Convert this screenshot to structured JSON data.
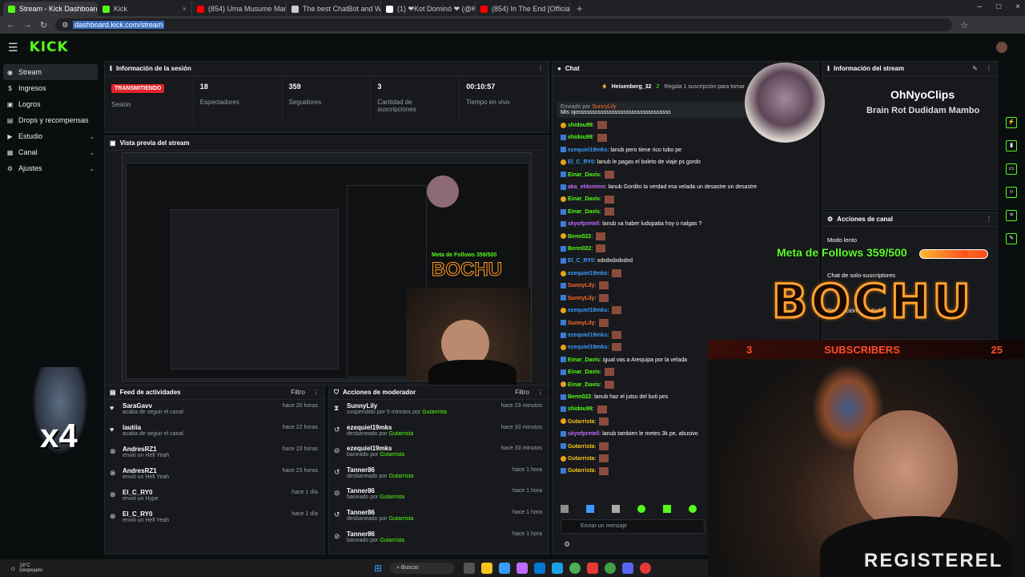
{
  "browser": {
    "tabs": [
      {
        "label": "Stream - Kick Dashboard",
        "active": true,
        "color": "#53fc18"
      },
      {
        "label": "Kick",
        "active": false,
        "color": "#53fc18"
      },
      {
        "label": "(854) Uma Musume Mambo #",
        "active": false,
        "color": "#ff0000"
      },
      {
        "label": "The best ChatBot and Widget",
        "active": false,
        "color": "#cccccc"
      },
      {
        "label": "(1) ❤Kot Dominó ❤ (@KotD",
        "active": false,
        "color": "#ffffff"
      },
      {
        "label": "(854) In The End [Official HD M",
        "active": false,
        "color": "#ff0000"
      }
    ],
    "url": "dashboard.kick.com/stream",
    "tab_close": "×",
    "new_tab": "+",
    "win_min": "–",
    "win_max": "□",
    "win_close": "×",
    "nav_back": "←",
    "nav_forward": "→",
    "nav_reload": "↻"
  },
  "kick": {
    "logo": "KICK"
  },
  "sidebar": [
    {
      "label": "Stream",
      "icon": "◉",
      "active": true
    },
    {
      "label": "Ingresos",
      "icon": "$"
    },
    {
      "label": "Logros",
      "icon": "▣"
    },
    {
      "label": "Drops y recompensas",
      "icon": "▤"
    },
    {
      "label": "Estudio",
      "icon": "▶",
      "chev": "⌄"
    },
    {
      "label": "Canal",
      "icon": "▦",
      "chev": "⌄"
    },
    {
      "label": "Ajustes",
      "icon": "⚙",
      "chev": "⌄"
    }
  ],
  "session": {
    "title": "Información de la sesión",
    "live_badge": "TRANSMITIENDO",
    "stats": [
      {
        "value": "",
        "label": "Sesión"
      },
      {
        "value": "18",
        "label": "Espectadores"
      },
      {
        "value": "359",
        "label": "Seguidores"
      },
      {
        "value": "3",
        "label": "Cantidad de suscripciones"
      },
      {
        "value": "00:10:57",
        "label": "Tiempo en vivo"
      }
    ]
  },
  "preview": {
    "title": "Vista previa del stream"
  },
  "activity": {
    "title": "Feed de actividades",
    "filter": "Filtro",
    "items": [
      {
        "icon": "♥",
        "user": "SaraGavv",
        "text": "acaba de seguir el canal",
        "time": "hace 20 horas"
      },
      {
        "icon": "♥",
        "user": "lautiia",
        "text": "acaba de seguir el canal",
        "time": "hace 22 horas"
      },
      {
        "icon": "⊗",
        "user": "AndresRZ1",
        "text": "envió un Hell Yeah",
        "extra": "1",
        "time": "hace 23 horas"
      },
      {
        "icon": "⊗",
        "user": "AndresRZ1",
        "text": "envió un Hell Yeah",
        "extra": "1",
        "time": "hace 23 horas"
      },
      {
        "icon": "⊗",
        "user": "El_C_RY0",
        "text": "envió un Hype",
        "extra": "10",
        "time": "hace 1 día"
      },
      {
        "icon": "⊗",
        "user": "El_C_RY0",
        "text": "envió un Hell Yeah",
        "extra": "1",
        "time": "hace 1 día"
      }
    ]
  },
  "mod": {
    "title": "Acciones de moderador",
    "filter": "Filtro",
    "items": [
      {
        "icon": "⧗",
        "user": "SunnyLily",
        "text": "suspendido por 5 minutos por",
        "by": "Gutarrista",
        "time": "hace 23 minutos"
      },
      {
        "icon": "↺",
        "user": "ezequiel19mks",
        "text": "desbaneado por",
        "by": "Gutarrista",
        "time": "hace 33 minutos"
      },
      {
        "icon": "⊘",
        "user": "ezequiel19mks",
        "text": "baneado por",
        "by": "Gutarrista",
        "time": "hace 33 minutos"
      },
      {
        "icon": "↺",
        "user": "Tanner86",
        "text": "desbaneado por",
        "by": "Gutarrista",
        "time": "hace 1 hora"
      },
      {
        "icon": "⊘",
        "user": "Tanner86",
        "text": "baneado por",
        "by": "Gutarrista",
        "time": "hace 1 hora"
      },
      {
        "icon": "↺",
        "user": "Tanner86",
        "text": "desbaneado por",
        "by": "Gutarrista",
        "time": "hace 1 hora"
      },
      {
        "icon": "⊘",
        "user": "Tanner86",
        "text": "baneado por",
        "by": "Gutarrista",
        "time": "hace 1 hora"
      }
    ]
  },
  "chat": {
    "title": "Chat",
    "pinned_user": "Heisenberg_32",
    "pinned_count": "2",
    "pinned_text": "Regala 1 suscripción para tomar",
    "reply_label": "Enviado por",
    "reply_user": "SunnyLily",
    "reply_text": "Mis ojosssssssssssssssssssssssssssssssss",
    "messages": [
      {
        "user": "shidou99",
        "cls": "u1",
        "text": "",
        "emote": true
      },
      {
        "user": "shidou99",
        "cls": "u1",
        "text": "",
        "emote": true
      },
      {
        "user": "ezequiel19mks",
        "cls": "u2",
        "text": "lanub pero tiene rico tubo pe"
      },
      {
        "user": "El_C_RY0",
        "cls": "u2",
        "text": "lanub le pagas el boleto de viaje ps gordo"
      },
      {
        "user": "Einar_Davis",
        "cls": "u1",
        "text": "",
        "emote": true
      },
      {
        "user": "aka_eldomino",
        "cls": "u3",
        "text": "lanub Gordito la verdad esa velada un desastre un desastre"
      },
      {
        "user": "Einar_Davis",
        "cls": "u1",
        "text": "",
        "emote": true
      },
      {
        "user": "Einar_Davis",
        "cls": "u1",
        "text": "",
        "emote": true
      },
      {
        "user": "skyofpretell",
        "cls": "u3",
        "text": "lanub va haber ludopatia hoy o nalgas ?"
      },
      {
        "user": "Benn022",
        "cls": "u1",
        "text": "",
        "emote": true
      },
      {
        "user": "Benn022",
        "cls": "u1",
        "text": "",
        "emote": true
      },
      {
        "user": "El_C_RY0",
        "cls": "u2",
        "text": "xdxdxdxdxdxd"
      },
      {
        "user": "ezequiel19mks",
        "cls": "u2",
        "text": "",
        "emote": true
      },
      {
        "user": "SunnyLily",
        "cls": "u4",
        "text": "",
        "emote": true
      },
      {
        "user": "SunnyLily",
        "cls": "u4",
        "text": "",
        "emote": true
      },
      {
        "user": "ezequiel19mks",
        "cls": "u2",
        "text": "",
        "emote": true
      },
      {
        "user": "SunnyLily",
        "cls": "u4",
        "text": "",
        "emote": true
      },
      {
        "user": "ezequiel19mks",
        "cls": "u2",
        "text": "",
        "emote": true
      },
      {
        "user": "ezequiel19mks",
        "cls": "u2",
        "text": "",
        "emote": true
      },
      {
        "user": "Einar_Davis",
        "cls": "u1",
        "text": "igual vas a Arequipa por la velada"
      },
      {
        "user": "Einar_Davis",
        "cls": "u1",
        "text": "",
        "emote": true
      },
      {
        "user": "Einar_Davis",
        "cls": "u1",
        "text": "",
        "emote": true
      },
      {
        "user": "Benn022",
        "cls": "u1",
        "text": "lanub haz el jutsu del buti pes"
      },
      {
        "user": "shidou99",
        "cls": "u1",
        "text": "",
        "emote": true
      },
      {
        "user": "Gutarrista",
        "cls": "u5",
        "text": "",
        "emote": true
      },
      {
        "user": "skyofpretell",
        "cls": "u3",
        "text": "lanub tambien le metes 3k pe, abusivo"
      },
      {
        "user": "Gutarrista",
        "cls": "u5",
        "text": "",
        "emote": true
      },
      {
        "user": "Gutarrista",
        "cls": "u5",
        "text": "",
        "emote": true
      },
      {
        "user": "Gutarrista",
        "cls": "u5",
        "text": "",
        "emote": true
      }
    ],
    "placeholder": "Enviar un mensaje"
  },
  "stream_info": {
    "title": "Información del stream"
  },
  "channel_actions": {
    "title": "Acciones de canal",
    "rows": [
      "Modo lento",
      "",
      "Chat de solo-suscriptores",
      "",
      "Restricción de edad"
    ]
  },
  "overlay": {
    "channel": "OhNyoClips",
    "song": "Brain Rot Dudidam Mambo",
    "goal_text": "Meta de Follows 359/500",
    "goal_progress": 0.718,
    "bochu": "BOCHU",
    "subs_label": "SUBSCRIBERS",
    "subs_left": "3",
    "subs_right": "25",
    "multiplier": "x4",
    "shirt": "REGISTEREL"
  },
  "taskbar": {
    "weather_temp": "18°C",
    "weather_text": "Despejado",
    "search": "Buscar"
  }
}
